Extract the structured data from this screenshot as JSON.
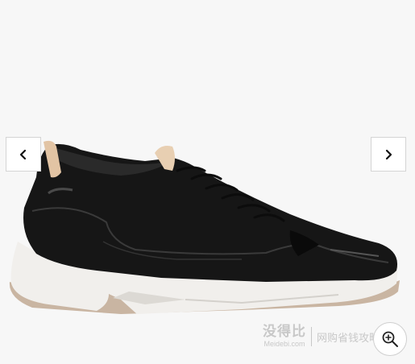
{
  "gallery": {
    "image_alt": "Black leather sneaker",
    "prev_icon": "chevron-left-icon",
    "next_icon": "chevron-right-icon",
    "zoom_icon": "zoom-in-icon"
  },
  "watermark": {
    "logo_text": "没得比",
    "site_text": "Meidebi.com",
    "slogan": "网购省钱攻略"
  },
  "colors": {
    "background": "#f7f7f7",
    "shoe_upper": "#161616",
    "sole": "#f1efec",
    "gum_sole": "#c9b5a2",
    "heel_tab": "#e2c4a4"
  }
}
